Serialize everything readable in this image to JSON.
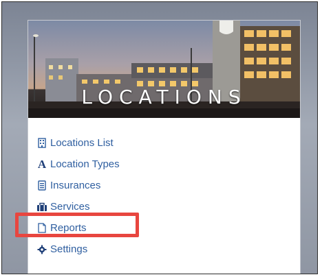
{
  "banner": {
    "title": "LOCATIONS"
  },
  "menu": {
    "items": [
      {
        "label": "Locations List",
        "icon": "building-icon"
      },
      {
        "label": "Location Types",
        "icon": "letter-a-icon"
      },
      {
        "label": "Insurances",
        "icon": "card-icon"
      },
      {
        "label": "Services",
        "icon": "briefcase-icon"
      },
      {
        "label": "Reports",
        "icon": "document-icon",
        "highlighted": true
      },
      {
        "label": "Settings",
        "icon": "gear-icon"
      }
    ]
  },
  "colors": {
    "link": "#2f5fa0",
    "highlight_box": "#e8463f",
    "frame_background": "#a3aab6"
  }
}
